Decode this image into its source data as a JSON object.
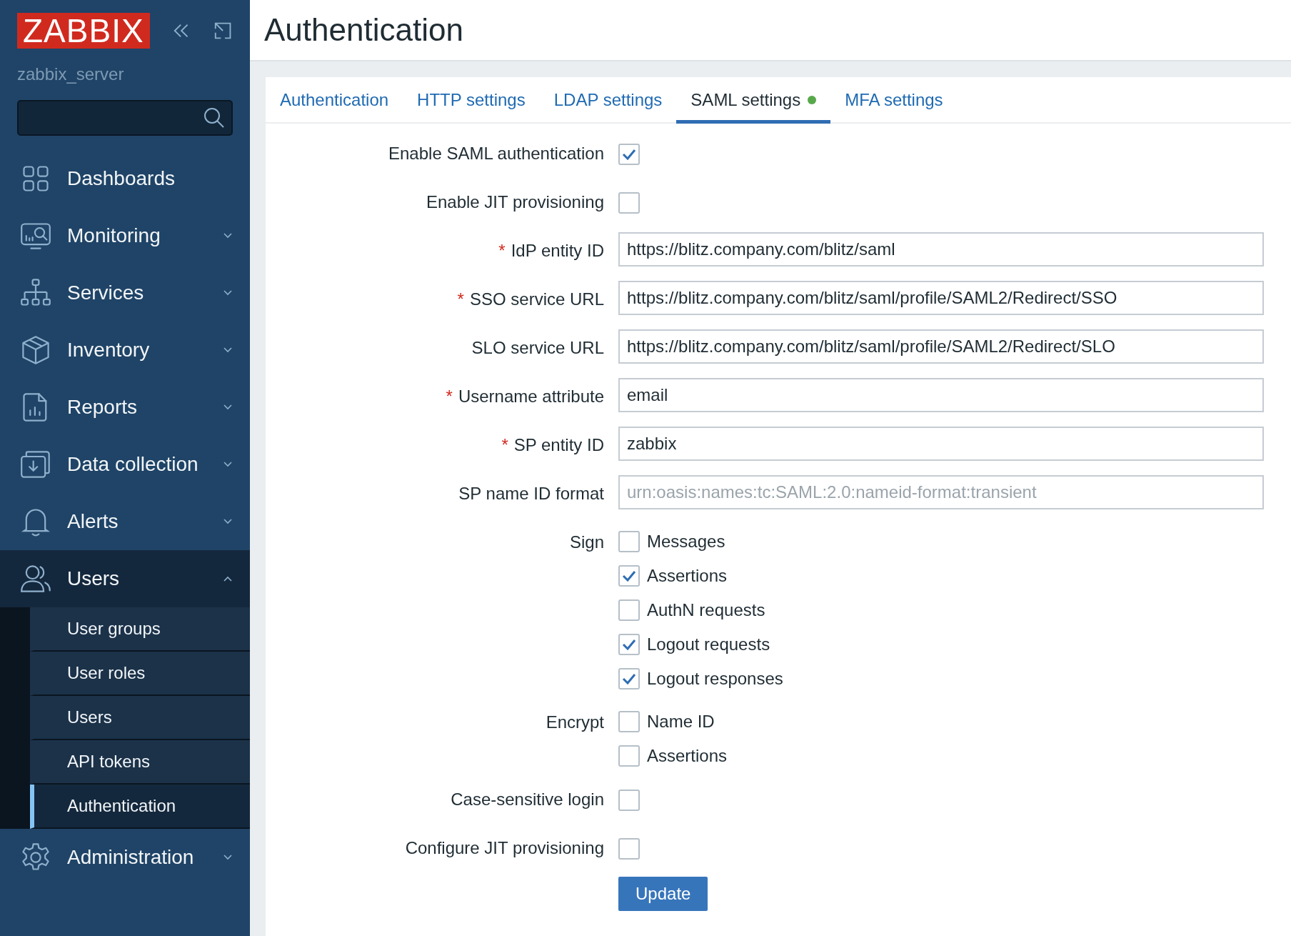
{
  "sidebar": {
    "logo": "ZABBIX",
    "server": "zabbix_server",
    "menu": [
      {
        "label": "Dashboards",
        "expandable": false,
        "expanded": false
      },
      {
        "label": "Monitoring",
        "expandable": true,
        "expanded": false
      },
      {
        "label": "Services",
        "expandable": true,
        "expanded": false
      },
      {
        "label": "Inventory",
        "expandable": true,
        "expanded": false
      },
      {
        "label": "Reports",
        "expandable": true,
        "expanded": false
      },
      {
        "label": "Data collection",
        "expandable": true,
        "expanded": false
      },
      {
        "label": "Alerts",
        "expandable": true,
        "expanded": false
      },
      {
        "label": "Users",
        "expandable": true,
        "expanded": true,
        "children": [
          {
            "label": "User groups",
            "selected": false
          },
          {
            "label": "User roles",
            "selected": false
          },
          {
            "label": "Users",
            "selected": false
          },
          {
            "label": "API tokens",
            "selected": false
          },
          {
            "label": "Authentication",
            "selected": true
          }
        ]
      },
      {
        "label": "Administration",
        "expandable": true,
        "expanded": false
      }
    ]
  },
  "page_title": "Authentication",
  "tabs": [
    {
      "label": "Authentication",
      "selected": false,
      "dot": false
    },
    {
      "label": "HTTP settings",
      "selected": false,
      "dot": false
    },
    {
      "label": "LDAP settings",
      "selected": false,
      "dot": false
    },
    {
      "label": "SAML settings",
      "selected": true,
      "dot": true
    },
    {
      "label": "MFA settings",
      "selected": false,
      "dot": false
    }
  ],
  "form": [
    {
      "kind": "checkbox",
      "label": "Enable SAML authentication",
      "checked": true
    },
    {
      "kind": "checkbox",
      "label": "Enable JIT provisioning",
      "checked": false
    },
    {
      "kind": "text",
      "required_mark": "*",
      "label": "IdP entity ID",
      "value": "https://blitz.company.com/blitz/saml"
    },
    {
      "kind": "text",
      "required_mark": "*",
      "label": "SSO service URL",
      "value": "https://blitz.company.com/blitz/saml/profile/SAML2/Redirect/SSO"
    },
    {
      "kind": "text",
      "label": "SLO service URL",
      "value": "https://blitz.company.com/blitz/saml/profile/SAML2/Redirect/SLO"
    },
    {
      "kind": "text",
      "required_mark": "*",
      "label": "Username attribute",
      "value": "email"
    },
    {
      "kind": "text",
      "required_mark": "*",
      "label": "SP entity ID",
      "value": "zabbix"
    },
    {
      "kind": "text",
      "label": "SP name ID format",
      "placeholder": "urn:oasis:names:tc:SAML:2.0:nameid-format:transient"
    },
    {
      "kind": "group",
      "label": "Sign",
      "options": [
        {
          "label": "Messages",
          "checked": false
        },
        {
          "label": "Assertions",
          "checked": true
        },
        {
          "label": "AuthN requests",
          "checked": false
        },
        {
          "label": "Logout requests",
          "checked": true
        },
        {
          "label": "Logout responses",
          "checked": true
        }
      ]
    },
    {
      "kind": "group",
      "label": "Encrypt",
      "options": [
        {
          "label": "Name ID",
          "checked": false
        },
        {
          "label": "Assertions",
          "checked": false
        }
      ]
    },
    {
      "kind": "checkbox",
      "label": "Case-sensitive login",
      "checked": false
    },
    {
      "kind": "checkbox",
      "label": "Configure JIT provisioning",
      "checked": false
    }
  ],
  "submit": "Update"
}
